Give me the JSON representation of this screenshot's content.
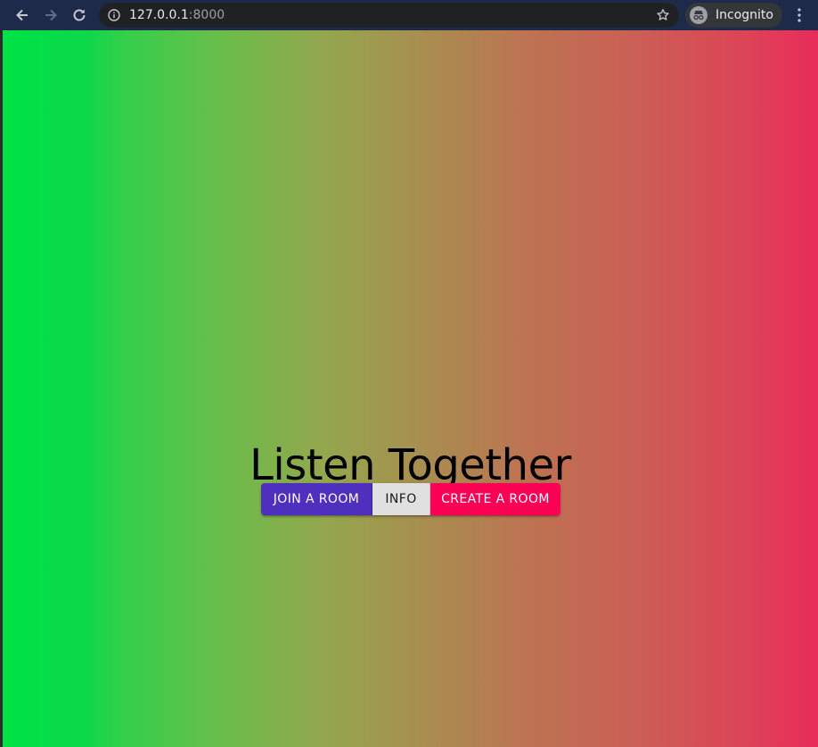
{
  "browser": {
    "url_host": "127.0.0.1",
    "url_port": ":8000",
    "profile_label": "Incognito"
  },
  "page": {
    "title": "Listen Together",
    "buttons": {
      "join": "JOIN A ROOM",
      "info": "INFO",
      "create": "CREATE A ROOM"
    }
  },
  "colors": {
    "join_button": "#4e2fbe",
    "info_button": "#e0e0e0",
    "create_button": "#fb0055",
    "gradient_start": "#00e146",
    "gradient_end": "#e82c5a",
    "toolbar": "#1e2a4a"
  },
  "icons": {
    "back": "arrow-left-icon",
    "forward": "arrow-right-icon",
    "reload": "reload-icon",
    "site_info": "info-icon",
    "bookmark": "star-icon",
    "profile": "incognito-icon",
    "menu": "kebab-menu-icon"
  }
}
